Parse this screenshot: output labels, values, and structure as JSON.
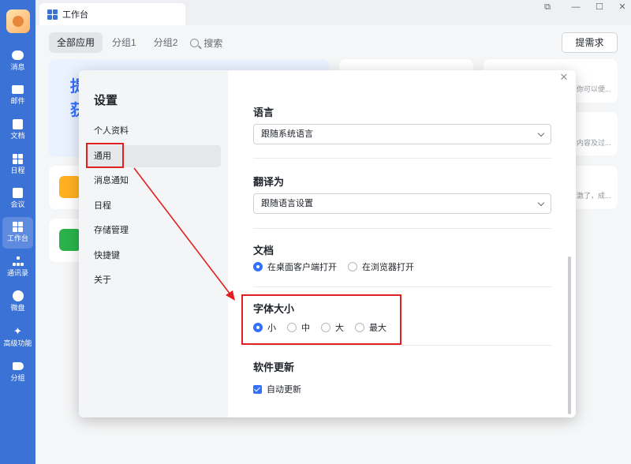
{
  "window": {
    "tab_title": "工作台",
    "controls": [
      "pin-icon",
      "minimize-icon",
      "maximize-icon",
      "close-icon"
    ]
  },
  "rail": {
    "items": [
      {
        "label": "消息",
        "icon": "chat-icon"
      },
      {
        "label": "邮件",
        "icon": "mail-icon"
      },
      {
        "label": "文档",
        "icon": "doc-icon"
      },
      {
        "label": "日程",
        "icon": "calendar-icon"
      },
      {
        "label": "会议",
        "icon": "meeting-icon"
      },
      {
        "label": "工作台",
        "icon": "workspace-icon",
        "active": true
      },
      {
        "label": "通讯录",
        "icon": "contacts-icon"
      },
      {
        "label": "微盘",
        "icon": "drive-icon"
      },
      {
        "label": "高级功能",
        "icon": "advanced-icon"
      },
      {
        "label": "分组",
        "icon": "group-icon"
      }
    ]
  },
  "workspace": {
    "filters": [
      "全部应用",
      "分组1",
      "分组2"
    ],
    "search_label": "搜索",
    "request_button": "提需求",
    "background_texts": [
      "提",
      "获",
      "你可以便...",
      "内容及过...",
      "激了，成..."
    ]
  },
  "dialog": {
    "title": "设置",
    "nav": [
      "个人资料",
      "通用",
      "消息通知",
      "日程",
      "存储管理",
      "快捷键",
      "关于"
    ],
    "active_nav": "通用",
    "language": {
      "title": "语言",
      "value": "跟随系统语言"
    },
    "translate": {
      "title": "翻译为",
      "value": "跟随语言设置"
    },
    "document": {
      "title": "文档",
      "options": [
        "在桌面客户端打开",
        "在浏览器打开"
      ],
      "selected": "在桌面客户端打开"
    },
    "font_size": {
      "title": "字体大小",
      "options": [
        "小",
        "中",
        "大",
        "最大"
      ],
      "selected": "小"
    },
    "update": {
      "title": "软件更新",
      "auto_update_label": "自动更新",
      "auto_update_checked": true
    }
  },
  "colors": {
    "rail": "#3b72d6",
    "accent": "#3370ff",
    "annotation": "#e02020"
  }
}
